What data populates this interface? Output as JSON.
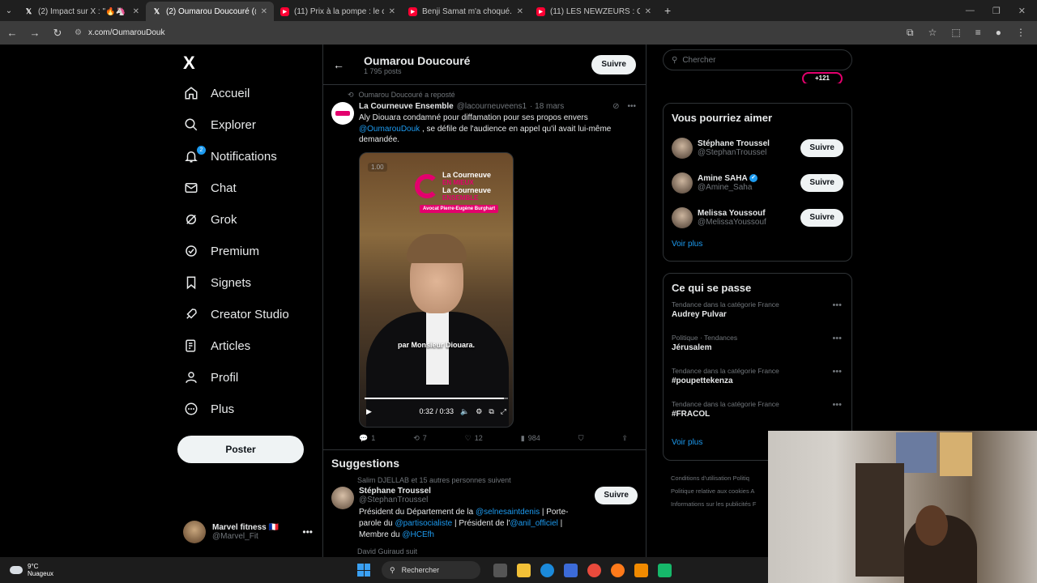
{
  "browser": {
    "tabs": [
      {
        "label": "(2) Impact sur X : \"🔥🦄 FLA",
        "favicon": "x-icon",
        "active": false
      },
      {
        "label": "(2) Oumarou Doucouré (@Oum",
        "favicon": "x-icon",
        "active": true
      },
      {
        "label": "(11) Prix à la pompe : le carbura",
        "favicon": "youtube-icon",
        "active": false
      },
      {
        "label": "Benji Samat m'a choqué... il est",
        "favicon": "youtube-icon",
        "active": false
      },
      {
        "label": "(11) LES NEWZEURS : CNC TAL",
        "favicon": "youtube-icon",
        "active": false
      }
    ],
    "new_tab": "+",
    "url": "x.com/OumarouDouk"
  },
  "nav": {
    "logo": "X",
    "items": [
      {
        "label": "Accueil",
        "icon": "home-icon"
      },
      {
        "label": "Explorer",
        "icon": "search-icon"
      },
      {
        "label": "Notifications",
        "icon": "bell-icon",
        "badge": "2"
      },
      {
        "label": "Chat",
        "icon": "mail-icon"
      },
      {
        "label": "Grok",
        "icon": "grok-icon"
      },
      {
        "label": "Premium",
        "icon": "premium-icon"
      },
      {
        "label": "Signets",
        "icon": "bookmark-icon"
      },
      {
        "label": "Creator Studio",
        "icon": "rocket-icon"
      },
      {
        "label": "Articles",
        "icon": "article-icon"
      },
      {
        "label": "Profil",
        "icon": "person-icon"
      },
      {
        "label": "Plus",
        "icon": "more-circle-icon"
      }
    ],
    "post_button": "Poster",
    "account": {
      "name": "Marvel fitness 🇫🇷",
      "handle": "@Marvel_Fit"
    }
  },
  "profile_header": {
    "name": "Oumarou Doucouré",
    "post_count": "1 795 posts",
    "follow_label": "Suivre"
  },
  "tweet": {
    "repost_line": "Oumarou Doucouré a reposté",
    "author": "La Courneuve Ensemble",
    "handle": "@lacourneuveens1",
    "date": "· 18 mars",
    "text_before": "Aly Diouara condamné pour diffamation pour ses propos envers ",
    "mention": "@OumarouDouk",
    "text_after": " , se défile de l'audience en appel qu'il avait lui-même demandée.",
    "video": {
      "chip": "1.00",
      "logo_line1": "La Courneuve",
      "logo_line2": "EN MIEUX",
      "logo_line3": "La Courneuve",
      "logo_line4": "ENSEMBLE",
      "logo_tag": "Avocat Pierre-Eugène Burghart",
      "caption": "par Monsieur Diouara.",
      "time": "0:32 / 0:33",
      "progress": 0.97
    },
    "stats": {
      "replies": "1",
      "reposts": "7",
      "likes": "12",
      "views": "984"
    }
  },
  "suggestions": {
    "title": "Suggestions",
    "social_line": "Salim DJELLAB et 15 autres personnes suivent",
    "name": "Stéphane Troussel",
    "handle": "@StephanTroussel",
    "bio_1": "Président du Département de la ",
    "bio_m1": "@selnesaintdenis",
    "bio_2": " | Porte-parole du ",
    "bio_m2": "@partisocialiste",
    "bio_3": " | Président de l'",
    "bio_m3": "@anil_officiel",
    "bio_4": " | Membre du ",
    "bio_m4": "@HCEfh",
    "follow": "Suivre",
    "next_line": "David Guiraud suit"
  },
  "right": {
    "search_placeholder": "Chercher",
    "partial_pill": "+121",
    "who_to_follow": {
      "title": "Vous pourriez aimer",
      "people": [
        {
          "name": "Stéphane Troussel",
          "handle": "@StephanTroussel",
          "verified": false
        },
        {
          "name": "Amine SAHA",
          "handle": "@Amine_Saha",
          "verified": true
        },
        {
          "name": "Melissa Youssouf",
          "handle": "@MelissaYoussouf",
          "verified": false
        }
      ],
      "follow": "Suivre",
      "more": "Voir plus"
    },
    "trends": {
      "title": "Ce qui se passe",
      "items": [
        {
          "category": "Tendance dans la catégorie France",
          "title": "Audrey Pulvar"
        },
        {
          "category": "Politique · Tendances",
          "title": "Jérusalem"
        },
        {
          "category": "Tendance dans la catégorie France",
          "title": "#poupettekenza"
        },
        {
          "category": "Tendance dans la catégorie France",
          "title": "#FRACOL"
        }
      ],
      "more": "Voir plus"
    },
    "footer": [
      "Conditions d'utilisation   Politiq",
      "Politique relative aux cookies   A",
      "Informations sur les publicités   F"
    ]
  },
  "taskbar": {
    "temp": "9°C",
    "weather": "Nuageux",
    "search": "Rechercher"
  },
  "colors": {
    "accent": "#1d9bf0",
    "pink": "#e3006d",
    "bg": "#000000",
    "border": "#2f3336"
  }
}
